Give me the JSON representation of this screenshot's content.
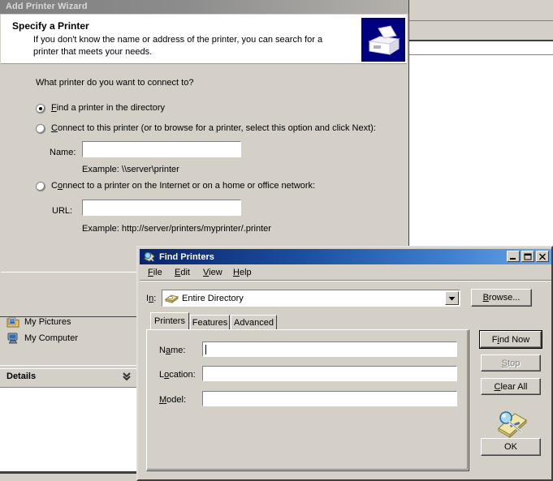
{
  "wizard": {
    "title": "Add Printer Wizard",
    "header_title": "Specify a Printer",
    "header_desc": "If you don't know the name or address of the printer, you can search for a printer that meets your needs.",
    "header_icon": "printer-icon",
    "question": "What printer do you want to connect to?",
    "options": [
      {
        "id": "find-in-directory",
        "label_pre": "",
        "accel": "F",
        "label_post": "ind a printer in the directory",
        "selected": true
      },
      {
        "id": "connect-to-printer",
        "label_pre": "",
        "accel": "C",
        "label_post": "onnect to this printer (or to browse for a printer, select this option and click Next):",
        "selected": false
      },
      {
        "id": "connect-internet-printer",
        "label_pre": "C",
        "accel": "o",
        "label_post": "nnect to a printer on the Internet or on a home or office network:",
        "selected": false
      }
    ],
    "name_label": "Name:",
    "name_value": "",
    "name_example": "Example: \\\\server\\printer",
    "url_label": "URL:",
    "url_value": "",
    "url_example": "Example: http://server/printers/myprinter/.printer"
  },
  "explorer": {
    "places": [
      {
        "label": "My Pictures",
        "icon": "pictures-folder-icon"
      },
      {
        "label": "My Computer",
        "icon": "computer-icon"
      }
    ],
    "details_label": "Details",
    "details_chevron": "chevron-double-down-icon"
  },
  "find_printers": {
    "title": "Find Printers",
    "title_icon": "find-printers-icon",
    "window_buttons": [
      {
        "name": "minimize-button",
        "glyph": "minimize-icon"
      },
      {
        "name": "maximize-button",
        "glyph": "maximize-icon"
      },
      {
        "name": "close-button",
        "glyph": "close-icon"
      }
    ],
    "menu": [
      {
        "accel": "F",
        "rest": "ile"
      },
      {
        "accel": "E",
        "rest": "dit"
      },
      {
        "accel": "V",
        "rest": "iew"
      },
      {
        "accel": "H",
        "rest": "elp"
      }
    ],
    "in_label_pre": "I",
    "in_label_accel": "n",
    "in_label_post": ":",
    "scope_value": "Entire Directory",
    "scope_icon": "directory-icon",
    "browse_button": {
      "pre": "",
      "accel": "B",
      "post": "rowse..."
    },
    "tabs": [
      {
        "label": "Printers",
        "active": true
      },
      {
        "label": "Features",
        "active": false
      },
      {
        "label": "Advanced",
        "active": false
      }
    ],
    "fields": [
      {
        "label_pre": "N",
        "accel": "a",
        "label_post": "me:",
        "value": "",
        "focused": true
      },
      {
        "label_pre": "L",
        "accel": "o",
        "label_post": "cation:",
        "value": "",
        "focused": false
      },
      {
        "label_pre": "",
        "accel": "M",
        "label_post": "odel:",
        "value": "",
        "focused": false
      }
    ],
    "actions": [
      {
        "id": "find-now",
        "pre": "F",
        "accel": "i",
        "post": "nd Now",
        "default": true,
        "disabled": false
      },
      {
        "id": "stop",
        "pre": "",
        "accel": "S",
        "post": "top",
        "default": false,
        "disabled": true
      },
      {
        "id": "clear-all",
        "pre": "",
        "accel": "C",
        "post": "lear All",
        "default": false,
        "disabled": false
      },
      {
        "id": "ok",
        "pre": "OK",
        "accel": "",
        "post": "",
        "default": false,
        "disabled": false
      }
    ],
    "search_icon": "magnifier-card-icon"
  },
  "colors": {
    "window_face": "#d4d0c8",
    "active_title_start": "#0a246a",
    "active_title_end": "#67a5e8",
    "inactive_title_start": "#808080",
    "inactive_title_end": "#b5b2ad",
    "icon_navy": "#000080",
    "disabled_text": "#808080"
  }
}
